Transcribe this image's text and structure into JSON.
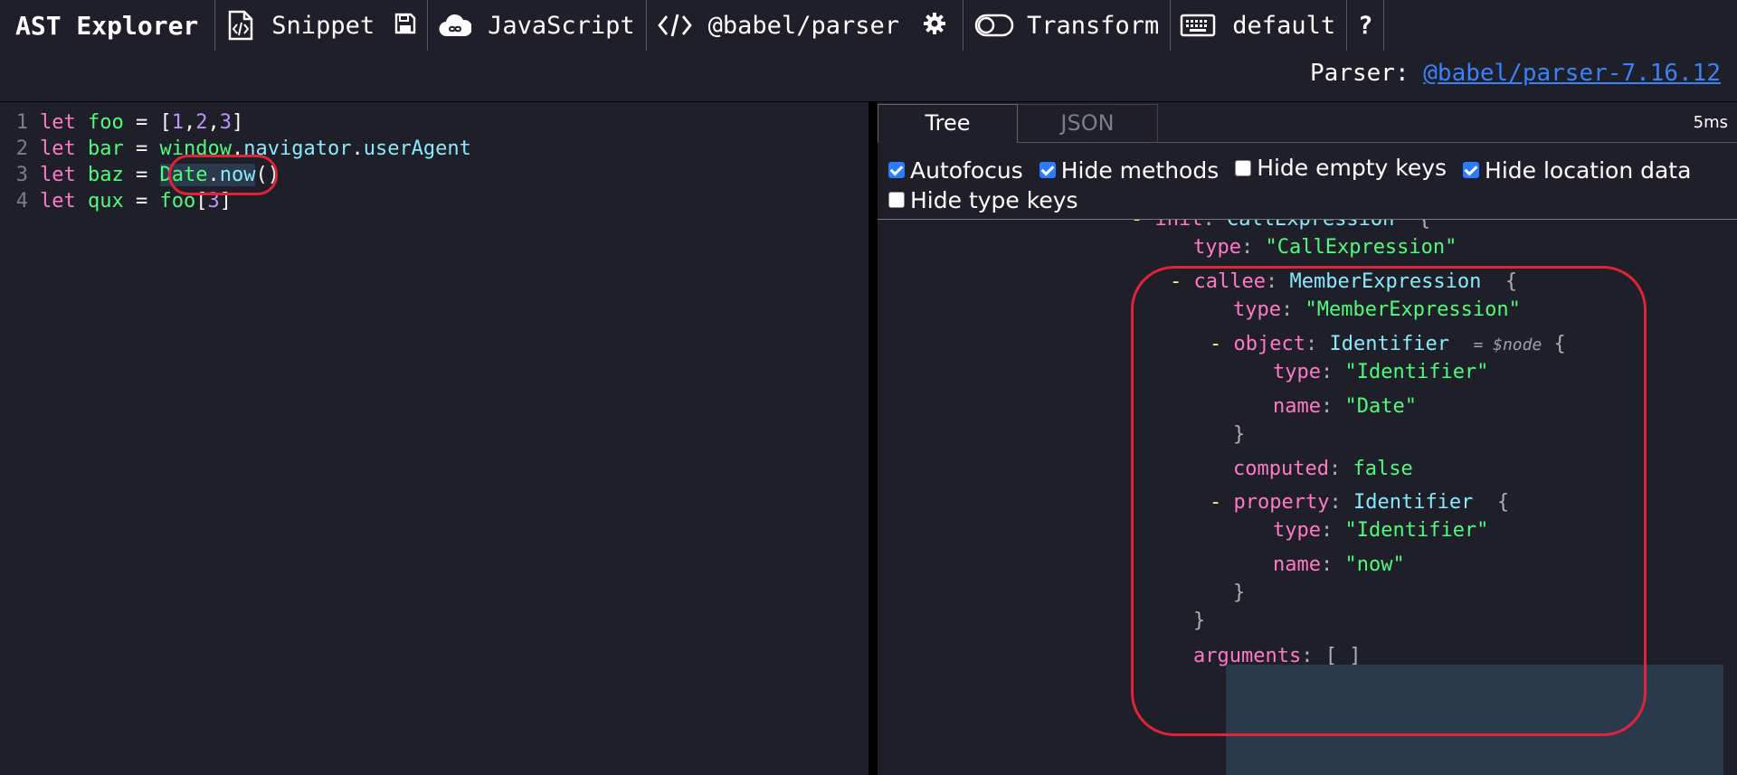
{
  "toolbar": {
    "brand": "AST Explorer",
    "snippet_label": "Snippet",
    "language_label": "JavaScript",
    "parser_label": "@babel/parser",
    "transform_label": "Transform",
    "keymap_label": "default",
    "help_label": "?"
  },
  "parser_info": {
    "prefix": "Parser:",
    "link_text": "@babel/parser-7.16.12"
  },
  "editor": {
    "lines": [
      {
        "num": "1",
        "t": [
          "let",
          "foo",
          "=",
          "[",
          "1",
          ",",
          "2",
          ",",
          "3",
          "]"
        ]
      },
      {
        "num": "2",
        "t": [
          "let",
          "bar",
          "=",
          "window",
          ".",
          "navigator",
          ".",
          "userAgent"
        ]
      },
      {
        "num": "3",
        "t": [
          "let",
          "baz",
          "=",
          "Date",
          ".",
          "now",
          "()"
        ]
      },
      {
        "num": "4",
        "t": [
          "let",
          "qux",
          "=",
          "foo",
          "[",
          "3",
          "]"
        ]
      }
    ]
  },
  "output_panel": {
    "tabs": [
      "Tree",
      "JSON"
    ],
    "active_tab": "Tree",
    "timing": "5ms",
    "options": [
      {
        "label": "Autofocus",
        "checked": true
      },
      {
        "label": "Hide methods",
        "checked": true
      },
      {
        "label": "Hide empty keys",
        "checked": false
      },
      {
        "label": "Hide location data",
        "checked": true
      },
      {
        "label": "Hide type keys",
        "checked": false
      }
    ]
  },
  "tree": {
    "init_key": "init",
    "init_type": "CallExpression",
    "t_type_key": "type",
    "t_type_val": "\"CallExpression\"",
    "callee_key": "callee",
    "callee_type": "MemberExpression",
    "callee_type_key": "type",
    "callee_type_val": "\"MemberExpression\"",
    "object_key": "object",
    "object_type": "Identifier",
    "object_ref": "= $node",
    "obj_type_key": "type",
    "obj_type_val": "\"Identifier\"",
    "obj_name_key": "name",
    "obj_name_val": "\"Date\"",
    "computed_key": "computed",
    "computed_val": "false",
    "property_key": "property",
    "property_type": "Identifier",
    "prop_type_key": "type",
    "prop_type_val": "\"Identifier\"",
    "prop_name_key": "name",
    "prop_name_val": "\"now\"",
    "arguments_key": "arguments",
    "arguments_val": "[ ]",
    "colon": ":",
    "open_brace": "{",
    "close_brace": "}",
    "toggle": "-"
  },
  "colors": {
    "background": "#1e1f29",
    "keyword": "#ff79c6",
    "identifier": "#50fa7b",
    "number": "#bd93f9",
    "property": "#8be9fd",
    "link": "#3b82f6",
    "annotation": "#e0233a",
    "selection": "#2a3a4c"
  }
}
